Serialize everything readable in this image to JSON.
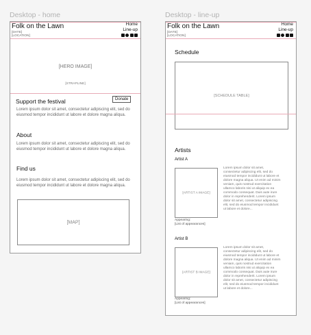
{
  "home": {
    "frame_label": "Desktop - home",
    "header": {
      "title": "Folk on the Lawn",
      "date": "[DATE]",
      "location": "[LOCATION]",
      "nav": [
        "Home",
        "Line-up"
      ],
      "social_icons": [
        "facebook-icon",
        "instagram-icon",
        "twitter-icon",
        "email-icon"
      ]
    },
    "hero": {
      "label": "[HERO IMAGE]",
      "strapline": "[STRAPLINE]"
    },
    "support": {
      "heading": "Support the festival",
      "donate_label": "Donate",
      "text": "Lorem ipsum dolor sit amet, consectetur adipiscing elit, sed do eiusmod tempor incididunt ut labore et dolore magna aliqua."
    },
    "about": {
      "heading": "About",
      "text": "Lorem ipsum dolor sit amet, consectetur adipiscing elit, sed do eiusmod tempor incididunt ut labore et dolore magna aliqua."
    },
    "find_us": {
      "heading": "Find us",
      "text": "Lorem ipsum dolor sit amet, consectetur adipiscing elit, sed do eiusmod tempor incididunt ut labore et dolore magna aliqua.",
      "map_label": "[MAP]"
    }
  },
  "lineup": {
    "frame_label": "Desktop - line-up",
    "header": {
      "title": "Folk on the Lawn",
      "date": "[DATE]",
      "location": "[LOCATION]",
      "nav": [
        "Home",
        "Line-up"
      ],
      "social_icons": [
        "facebook-icon",
        "instagram-icon",
        "twitter-icon",
        "email-icon"
      ]
    },
    "schedule": {
      "heading": "Schedule",
      "table_label": "[SCHEDULE TABLE]"
    },
    "artists": {
      "heading": "Artists",
      "items": [
        {
          "name": "Artist A",
          "image_label": "[ARTIST A IMAGE]",
          "appearing": "Appearing:",
          "appearances": "[List of appearances]",
          "bio": "Lorem ipsum dolor sit amet, consectetur adipiscing elit, sed do eiusmod tempor incididunt ut labore et dolore magna aliqua. Ut enim ad minim veniam, quis nostrud exercitation ullamco laboris nisi ut aliquip ex ea commodo consequat. Duis aute irure dolor in reprehenderit. Lorem ipsum dolor sit amet, consectetur adipiscing elit, sed do eiusmod tempor incididunt ut labore et dolore..."
        },
        {
          "name": "Artist B",
          "image_label": "[ARTIST B IMAGE]",
          "appearing": "Appearing:",
          "appearances": "[List of appearances]",
          "bio": "Lorem ipsum dolor sit amet, consectetur adipiscing elit, sed do eiusmod tempor incididunt ut labore et dolore magna aliqua. Ut enim ad minim veniam, quis nostrud exercitation ullamco laboris nisi ut aliquip ex ea commodo consequat. Duis aute irure dolor in reprehenderit. Lorem ipsum dolor sit amet, consectetur adipiscing elit, sed do eiusmod tempor incididunt ut labore et dolore..."
        }
      ]
    }
  },
  "colors": {
    "guide_line": "#e8a9b6",
    "frame_border": "#9a9a9a",
    "label_gray": "#b3b3b3"
  }
}
